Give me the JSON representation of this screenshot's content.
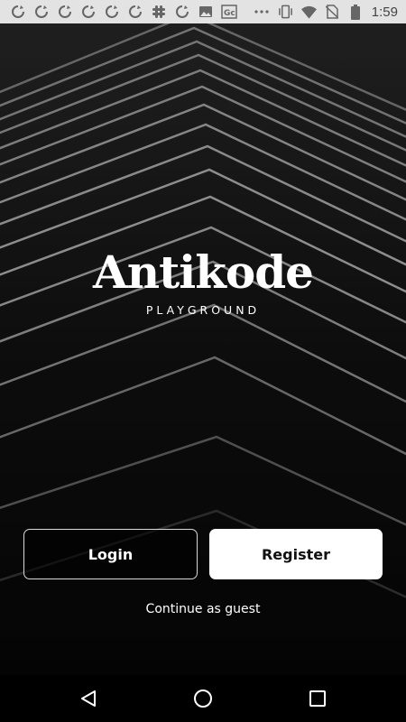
{
  "status_bar": {
    "time": "1:59",
    "left_icons": [
      "sync-icon",
      "sync-icon",
      "sync-icon",
      "sync-icon",
      "sync-icon",
      "sync-icon",
      "slack-icon",
      "sync-icon",
      "image-icon",
      "gc-icon"
    ],
    "right_icons": [
      "more-icon",
      "vibrate-icon",
      "wifi-icon",
      "no-sim-icon",
      "battery-icon"
    ]
  },
  "brand": {
    "title": "Antikode",
    "subtitle": "PLAYGROUND"
  },
  "actions": {
    "login_label": "Login",
    "register_label": "Register",
    "guest_label": "Continue as guest"
  },
  "navigation": {
    "icons": [
      "back-icon",
      "home-icon",
      "recents-icon"
    ]
  },
  "colors": {
    "background": "#0c0c0c",
    "button_primary": "#ffffff",
    "text": "#ffffff"
  }
}
